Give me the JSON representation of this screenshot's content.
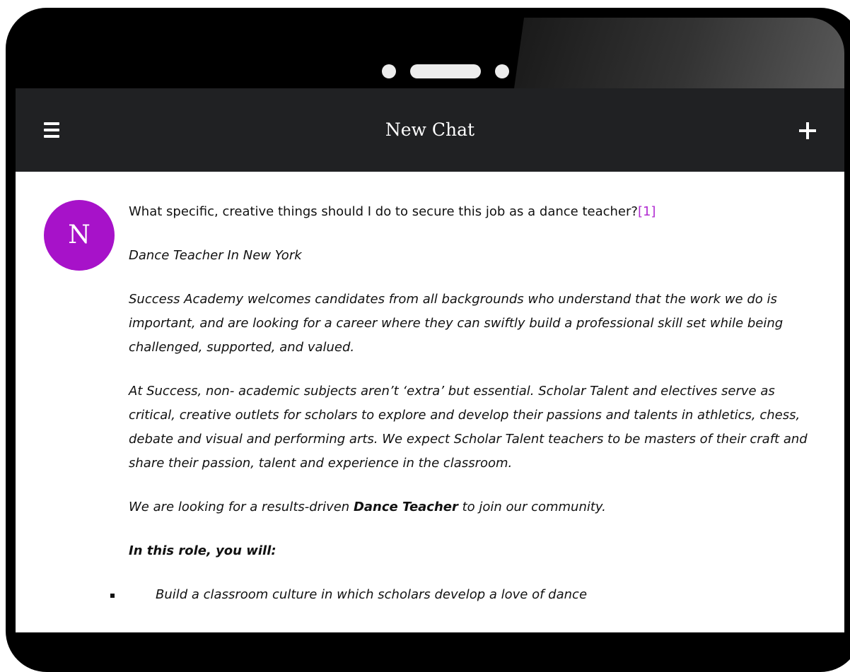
{
  "device": {
    "bezel_color": "#000000"
  },
  "header": {
    "title": "New Chat",
    "menu_icon": "hamburger-menu-icon",
    "new_chat_icon": "plus-icon",
    "background": "#202123"
  },
  "user": {
    "avatar_letter": "N",
    "avatar_color": "#a712c9"
  },
  "message": {
    "question": "What specific, creative things should I do to secure this job as a dance teacher?",
    "reference": "[1]",
    "job_title": "Dance Teacher In New York",
    "paragraph1": "Success Academy welcomes candidates from all backgrounds who understand that the work we do is important, and are looking for a career where they can swiftly build a professional skill set while being challenged, supported, and valued.",
    "paragraph2": "At Success, non- academic subjects aren’t ‘extra’ but essential. Scholar Talent and electives serve as critical, creative outlets for scholars to explore and develop their passions and talents in athletics, chess, debate and visual and performing arts. We expect Scholar Talent teachers to be masters of their craft and share their passion, talent and experience in the classroom.",
    "paragraph3_before": "We are looking for a results-driven ",
    "paragraph3_bold": "Dance Teacher",
    "paragraph3_after": " to join our community.",
    "role_heading": "In this role, you will:",
    "role_items": [
      "Build a classroom culture in which scholars develop a love of dance"
    ]
  }
}
